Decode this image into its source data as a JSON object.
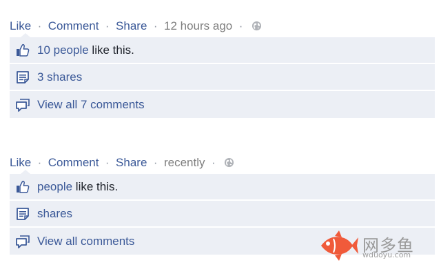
{
  "posts": [
    {
      "actions": {
        "like": "Like",
        "comment": "Comment",
        "share": "Share",
        "sep": "·",
        "time": "12 hours ago"
      },
      "likes": {
        "count_link": "10 people",
        "suffix": " like this."
      },
      "shares": {
        "label": "3 shares"
      },
      "comments": {
        "label": "View all 7 comments"
      }
    },
    {
      "actions": {
        "like": "Like",
        "comment": "Comment",
        "share": "Share",
        "sep": "·",
        "time": "recently"
      },
      "likes": {
        "count_link": "people",
        "suffix": " like this."
      },
      "shares": {
        "label": "shares"
      },
      "comments": {
        "label": "View all comments"
      }
    }
  ],
  "watermark": {
    "cn": "网多鱼",
    "en": "wduoyu.com"
  },
  "icons": {
    "globe": "globe-icon",
    "like": "thumbs-up-icon",
    "share": "share-doc-icon",
    "comment": "comment-bubble-icon",
    "fish": "fish-logo-icon"
  },
  "colors": {
    "link": "#3b5998",
    "panel": "#eceff5",
    "meta": "#7f7f7f",
    "logo": "#f05a3a"
  }
}
